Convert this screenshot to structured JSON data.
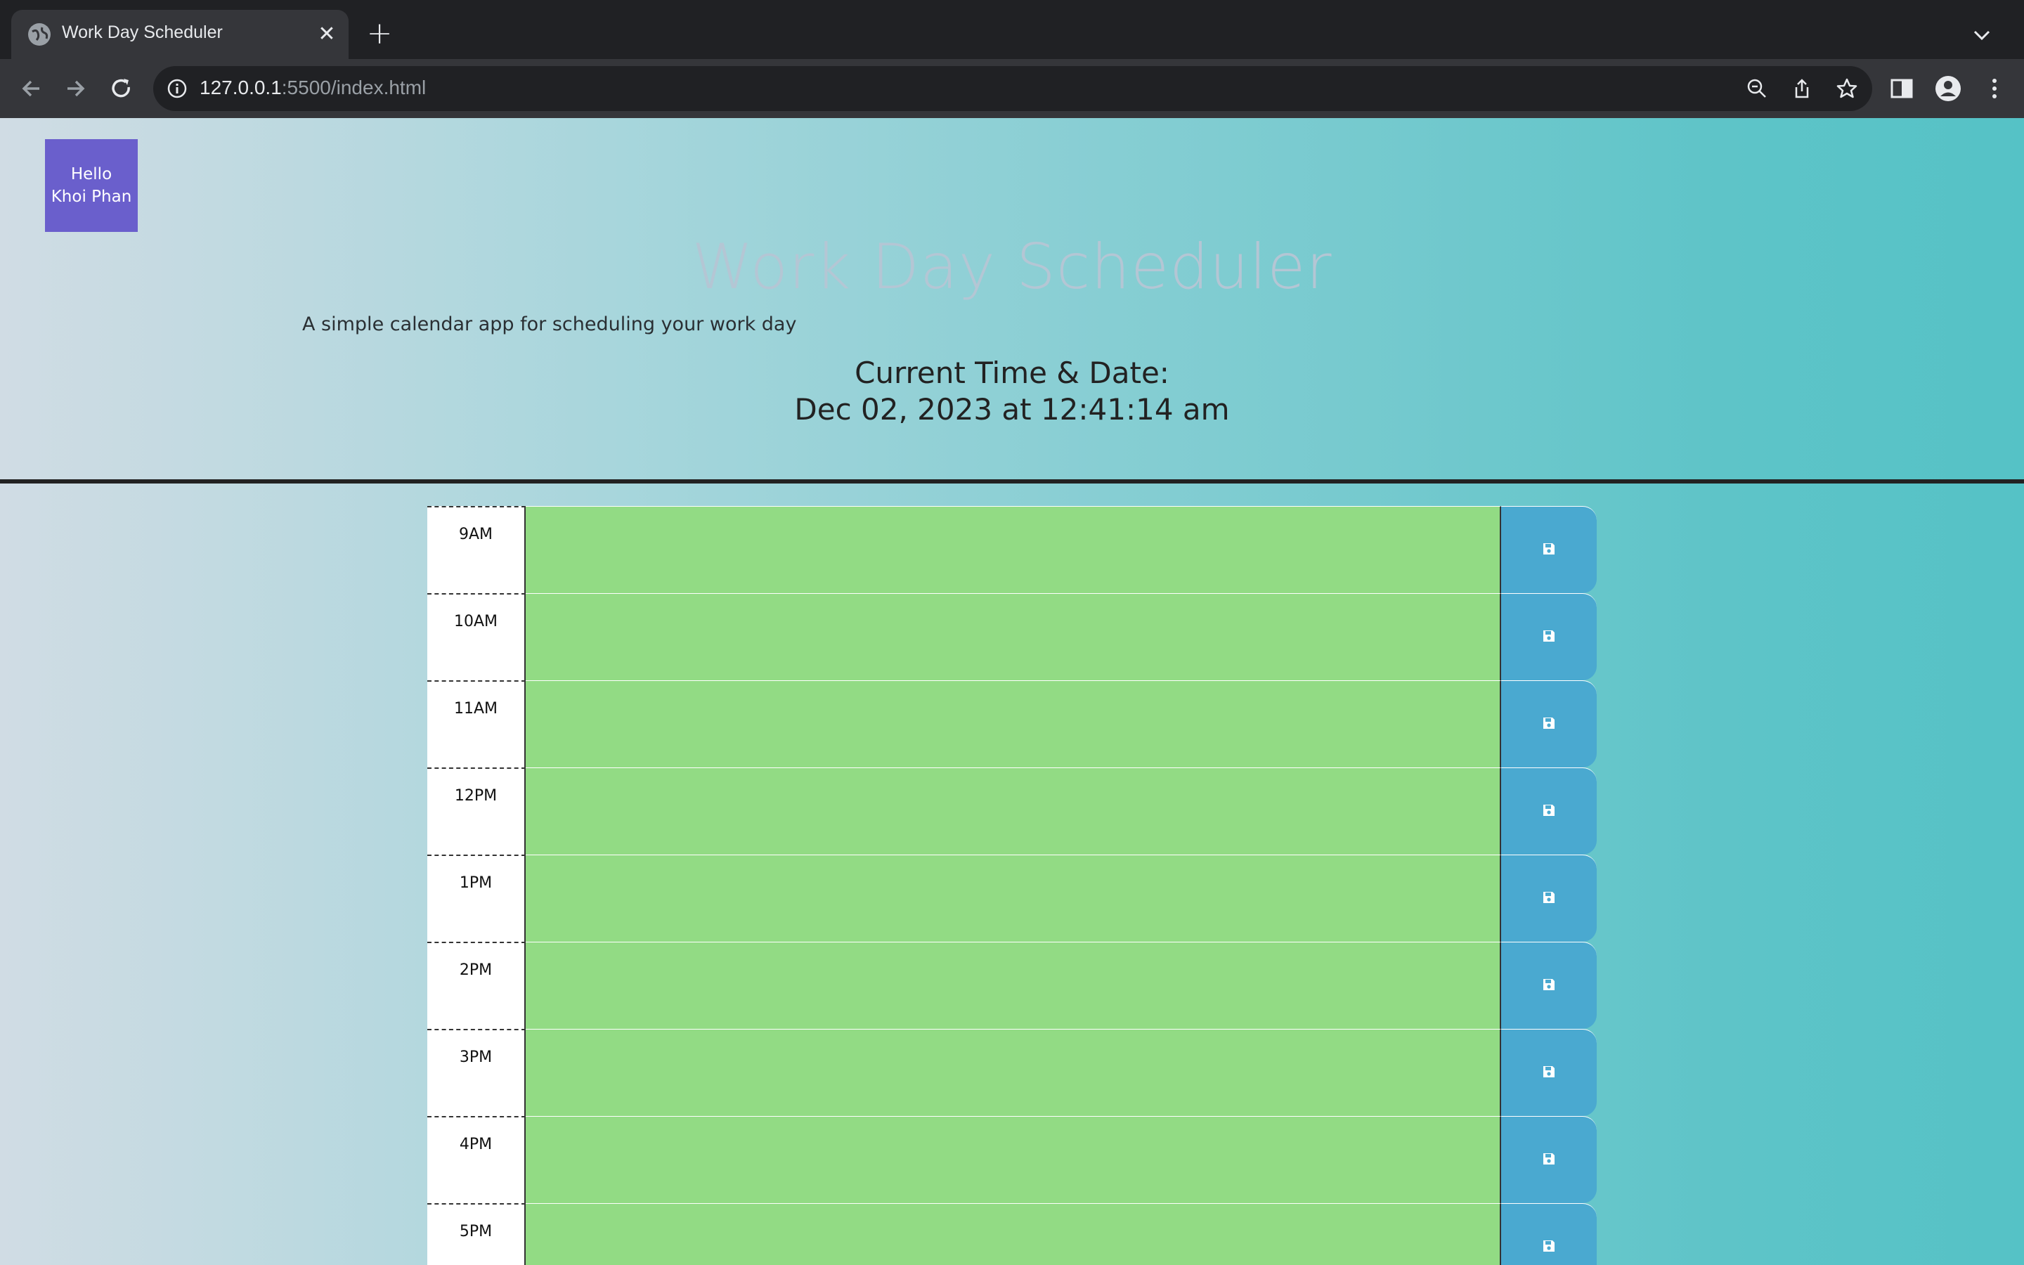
{
  "browser": {
    "tab_title": "Work Day Scheduler",
    "url_host": "127.0.0.1",
    "url_rest": ":5500/index.html"
  },
  "page": {
    "greeting_line1": "Hello",
    "greeting_line2": "Khoi Phan",
    "title": "Work Day Scheduler",
    "subtitle": "A simple calendar app for scheduling your work day",
    "time_heading": "Current Time & Date:",
    "time_value": "Dec 02, 2023 at 12:41:14 am"
  },
  "schedule": {
    "rows": [
      {
        "hour": "9AM",
        "description": ""
      },
      {
        "hour": "10AM",
        "description": ""
      },
      {
        "hour": "11AM",
        "description": ""
      },
      {
        "hour": "12PM",
        "description": ""
      },
      {
        "hour": "1PM",
        "description": ""
      },
      {
        "hour": "2PM",
        "description": ""
      },
      {
        "hour": "3PM",
        "description": ""
      },
      {
        "hour": "4PM",
        "description": ""
      },
      {
        "hour": "5PM",
        "description": ""
      }
    ],
    "save_icon": "floppy-disk-icon"
  },
  "colors": {
    "chrome_dark": "#202124",
    "chrome_toolbar": "#35363a",
    "greeting_bg": "#6a5fcc",
    "present_row": "#92db84",
    "save_button": "#4aa9d0"
  }
}
